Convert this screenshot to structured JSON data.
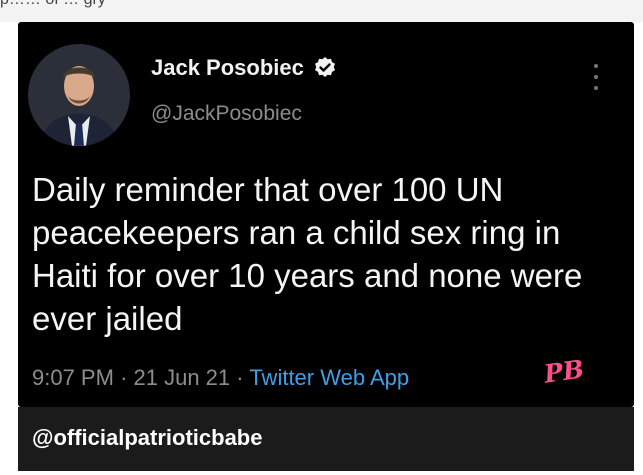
{
  "top_crop": {
    "text": "p…… of … gry"
  },
  "tweet": {
    "display_name": "Jack Posobiec",
    "handle": "@JackPosobiec",
    "verified_icon": "verified-badge-icon",
    "more_icon": "vertical-more-icon",
    "text": "Daily reminder that over 100 UN peacekeepers ran a child sex ring in Haiti for over 10 years and none were ever jailed",
    "time": "9:07 PM",
    "separator": "·",
    "date": "21 Jun 21",
    "app": "Twitter Web App",
    "colors": {
      "background": "#000000",
      "text": "#f5f5f5",
      "muted": "#8d8d8d",
      "link": "#3f9ee8"
    }
  },
  "overlay_mark": {
    "text": "PB",
    "color": "#ff4f8a"
  },
  "footer": {
    "watermark": "@officialpatrioticbabe",
    "background": "#1b1b1b"
  }
}
